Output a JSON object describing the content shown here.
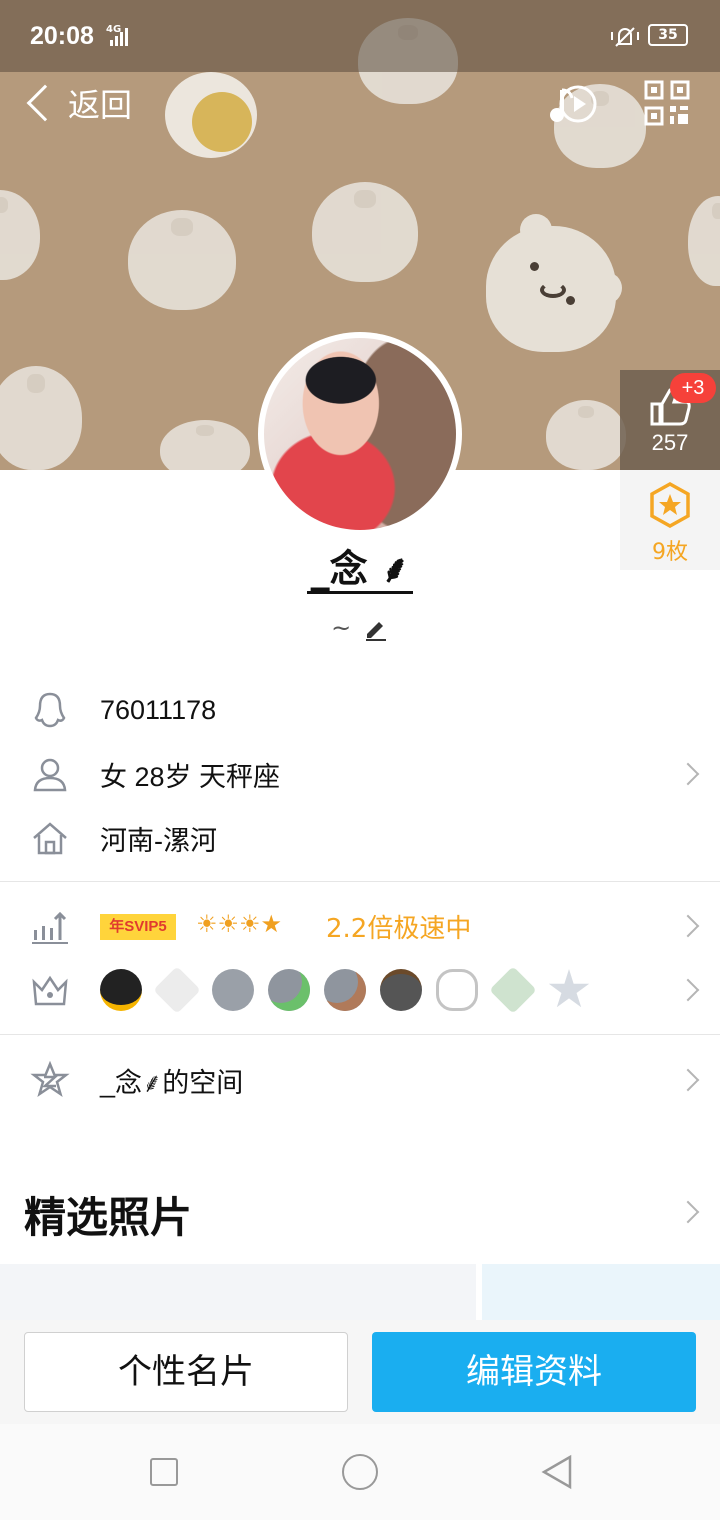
{
  "status_bar": {
    "time": "20:08",
    "network": "4G",
    "battery": "35"
  },
  "header": {
    "back_label": "返回",
    "music_icon": "music-play-icon",
    "qr_icon": "qr-code-icon"
  },
  "profile": {
    "likes_badge": "+3",
    "likes_count": "257",
    "medal_count": "9枚",
    "nickname": "_念",
    "nickname_ornament": "⸙",
    "signature": "~"
  },
  "info": {
    "qq_number": "76011178",
    "gender_age_sign": "女  28岁  天秤座",
    "location": "河南-漯河"
  },
  "vip": {
    "svip_label": "年SVIP5",
    "suns": "☀☀☀★",
    "speed_text": "2.2倍极速中"
  },
  "space": {
    "label": "_念⸙的空间"
  },
  "photos": {
    "section_title": "精选照片"
  },
  "actions": {
    "card_button": "个性名片",
    "edit_button": "编辑资料"
  },
  "colors": {
    "accent_blue": "#1aaef0",
    "speed_orange": "#f5a623",
    "badge_red": "#f6413a",
    "cover_tan": "#b59a7c"
  }
}
